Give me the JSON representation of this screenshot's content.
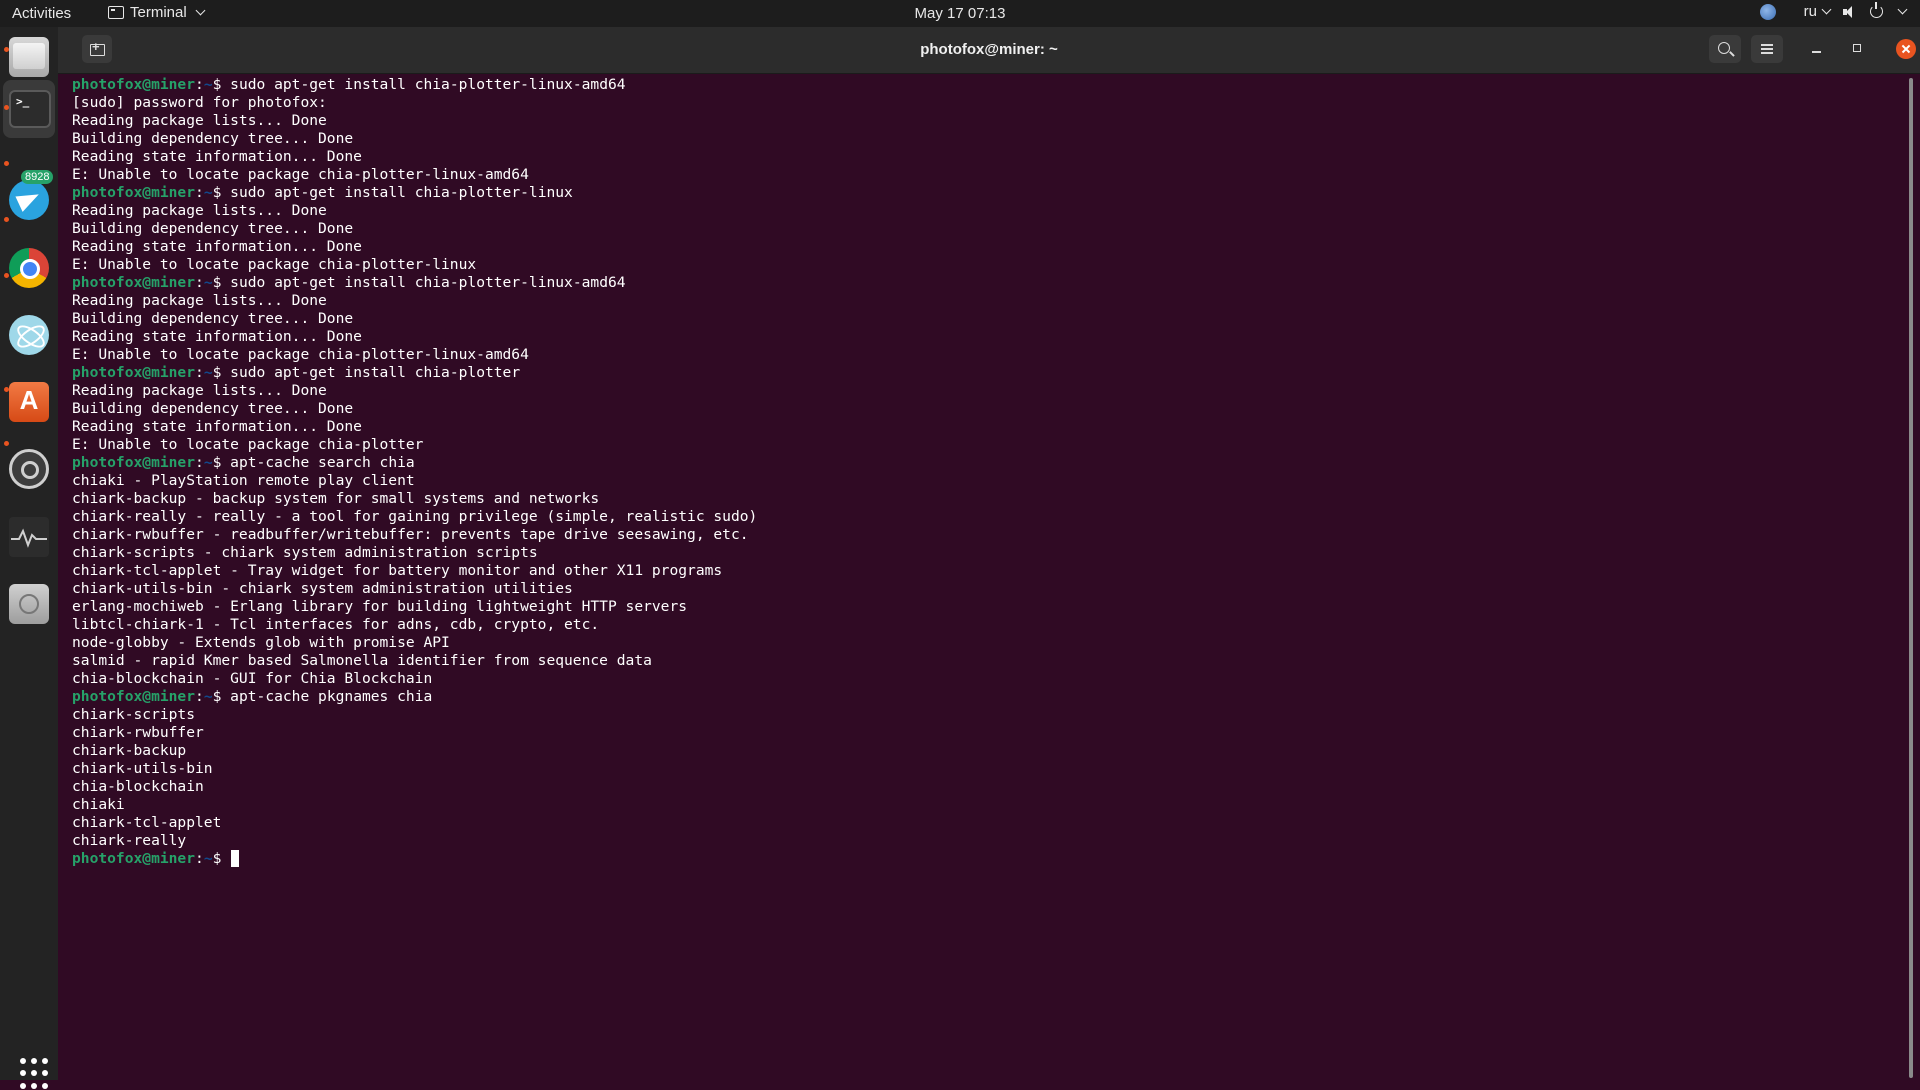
{
  "topbar": {
    "activities": "Activities",
    "app_name": "Terminal",
    "clock": "May 17  07:13",
    "lang": "ru"
  },
  "dock": {
    "telegram_badge": "8928",
    "store_glyph": "A",
    "terminal_glyph": ">_"
  },
  "window": {
    "title": "photofox@miner: ~"
  },
  "terminal": {
    "prompt_user": "photofox@miner",
    "prompt_dir": "~",
    "lines": [
      {
        "type": "cmd",
        "text": "sudo apt-get install chia-plotter-linux-amd64"
      },
      {
        "type": "out",
        "text": "[sudo] password for photofox:"
      },
      {
        "type": "out",
        "text": "Reading package lists... Done"
      },
      {
        "type": "out",
        "text": "Building dependency tree... Done"
      },
      {
        "type": "out",
        "text": "Reading state information... Done"
      },
      {
        "type": "out",
        "text": "E: Unable to locate package chia-plotter-linux-amd64"
      },
      {
        "type": "cmd",
        "text": "sudo apt-get install chia-plotter-linux"
      },
      {
        "type": "out",
        "text": "Reading package lists... Done"
      },
      {
        "type": "out",
        "text": "Building dependency tree... Done"
      },
      {
        "type": "out",
        "text": "Reading state information... Done"
      },
      {
        "type": "out",
        "text": "E: Unable to locate package chia-plotter-linux"
      },
      {
        "type": "cmd",
        "text": "sudo apt-get install chia-plotter-linux-amd64"
      },
      {
        "type": "out",
        "text": "Reading package lists... Done"
      },
      {
        "type": "out",
        "text": "Building dependency tree... Done"
      },
      {
        "type": "out",
        "text": "Reading state information... Done"
      },
      {
        "type": "out",
        "text": "E: Unable to locate package chia-plotter-linux-amd64"
      },
      {
        "type": "cmd",
        "text": "sudo apt-get install chia-plotter"
      },
      {
        "type": "out",
        "text": "Reading package lists... Done"
      },
      {
        "type": "out",
        "text": "Building dependency tree... Done"
      },
      {
        "type": "out",
        "text": "Reading state information... Done"
      },
      {
        "type": "out",
        "text": "E: Unable to locate package chia-plotter"
      },
      {
        "type": "cmd",
        "text": "apt-cache search chia"
      },
      {
        "type": "out",
        "text": "chiaki - PlayStation remote play client"
      },
      {
        "type": "out",
        "text": "chiark-backup - backup system for small systems and networks"
      },
      {
        "type": "out",
        "text": "chiark-really - really - a tool for gaining privilege (simple, realistic sudo)"
      },
      {
        "type": "out",
        "text": "chiark-rwbuffer - readbuffer/writebuffer: prevents tape drive seesawing, etc."
      },
      {
        "type": "out",
        "text": "chiark-scripts - chiark system administration scripts"
      },
      {
        "type": "out",
        "text": "chiark-tcl-applet - Tray widget for battery monitor and other X11 programs"
      },
      {
        "type": "out",
        "text": "chiark-utils-bin - chiark system administration utilities"
      },
      {
        "type": "out",
        "text": "erlang-mochiweb - Erlang library for building lightweight HTTP servers"
      },
      {
        "type": "out",
        "text": "libtcl-chiark-1 - Tcl interfaces for adns, cdb, crypto, etc."
      },
      {
        "type": "out",
        "text": "node-globby - Extends glob with promise API"
      },
      {
        "type": "out",
        "text": "salmid - rapid Kmer based Salmonella identifier from sequence data"
      },
      {
        "type": "out",
        "text": "chia-blockchain - GUI for Chia Blockchain"
      },
      {
        "type": "cmd",
        "text": "apt-cache pkgnames chia"
      },
      {
        "type": "out",
        "text": "chiark-scripts"
      },
      {
        "type": "out",
        "text": "chiark-rwbuffer"
      },
      {
        "type": "out",
        "text": "chiark-backup"
      },
      {
        "type": "out",
        "text": "chiark-utils-bin"
      },
      {
        "type": "out",
        "text": "chia-blockchain"
      },
      {
        "type": "out",
        "text": "chiaki"
      },
      {
        "type": "out",
        "text": "chiark-tcl-applet"
      },
      {
        "type": "out",
        "text": "chiark-really"
      },
      {
        "type": "prompt",
        "text": ""
      }
    ]
  }
}
